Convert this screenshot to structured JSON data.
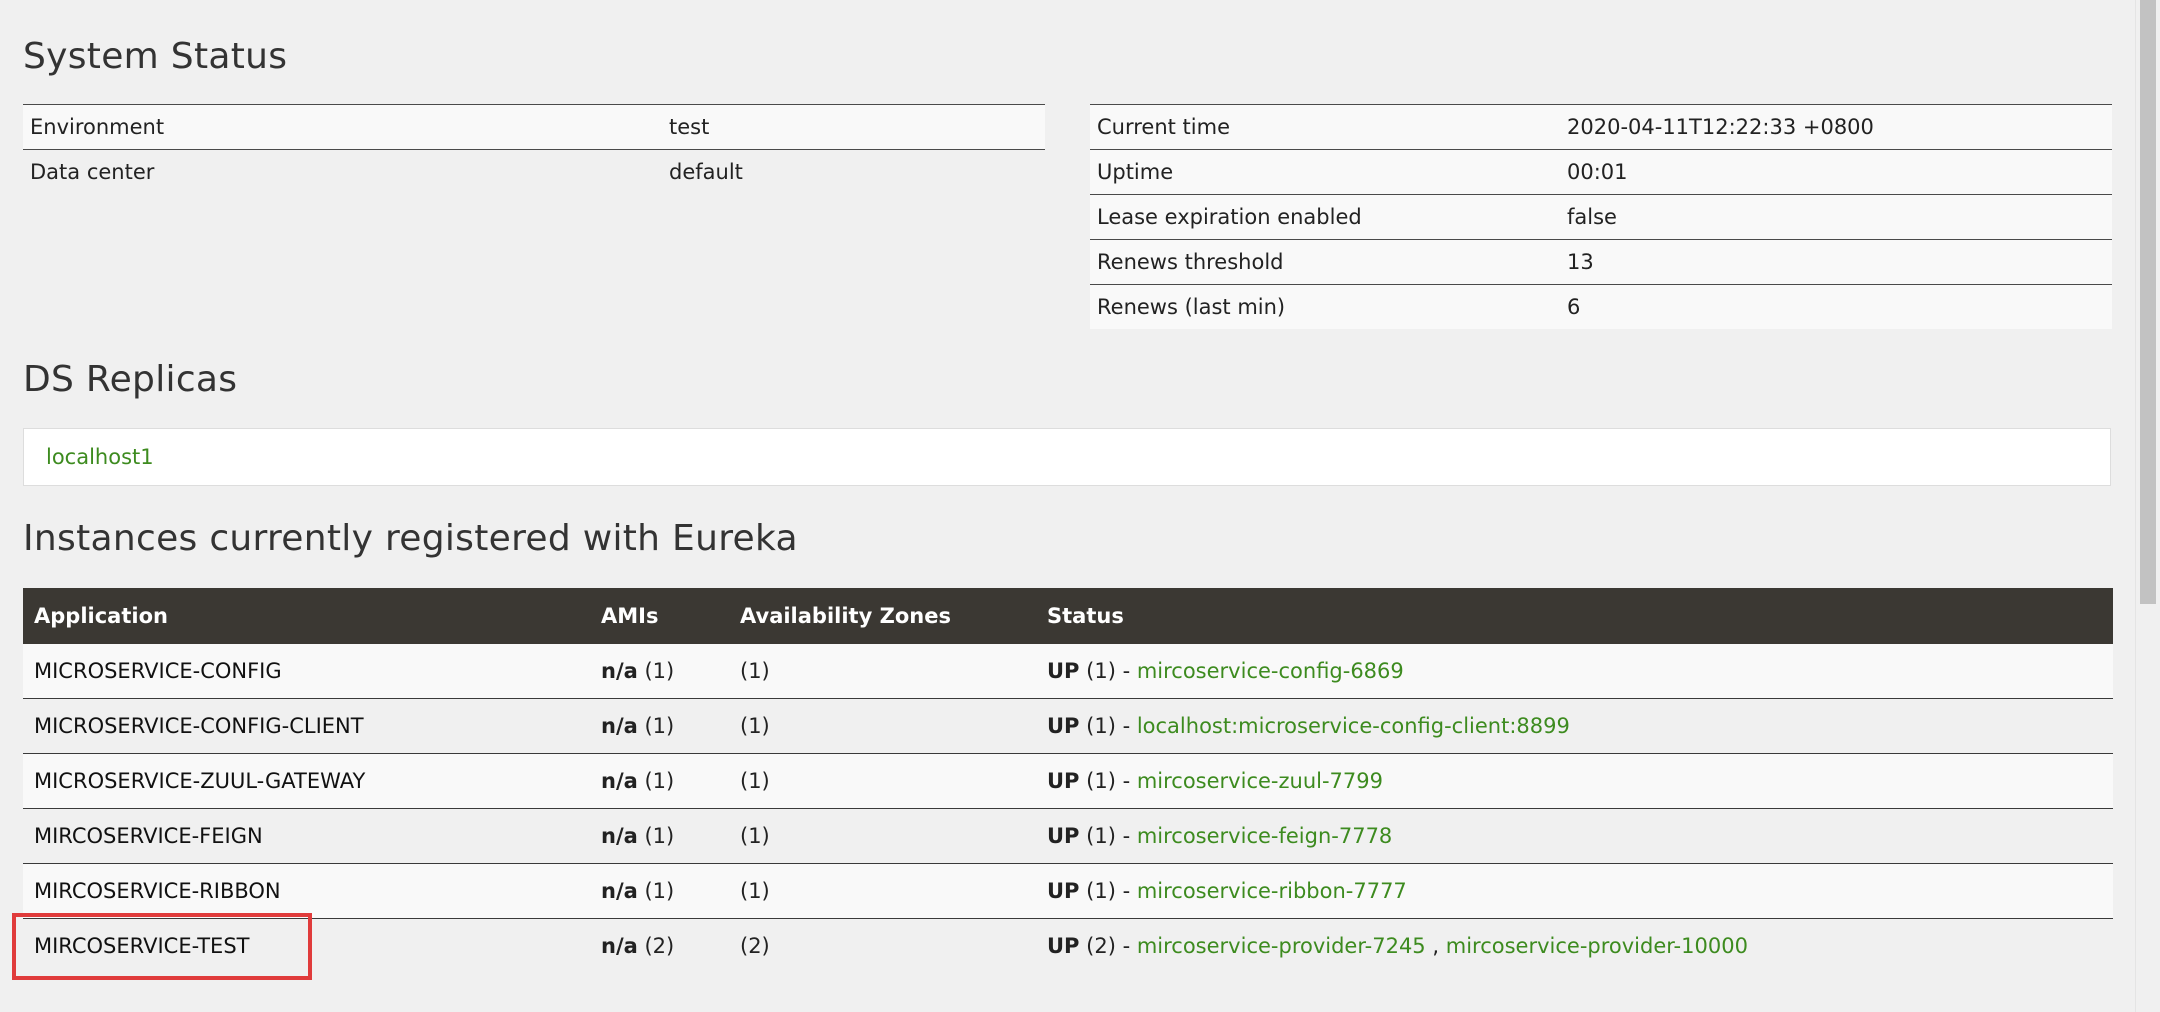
{
  "system_status": {
    "title": "System Status",
    "left_rows": [
      {
        "label": "Environment",
        "value": "test"
      },
      {
        "label": "Data center",
        "value": "default"
      }
    ],
    "right_rows": [
      {
        "label": "Current time",
        "value": "2020-04-11T12:22:33 +0800"
      },
      {
        "label": "Uptime",
        "value": "00:01"
      },
      {
        "label": "Lease expiration enabled",
        "value": "false"
      },
      {
        "label": "Renews threshold",
        "value": "13"
      },
      {
        "label": "Renews (last min)",
        "value": "6"
      }
    ]
  },
  "ds_replicas": {
    "title": "DS Replicas",
    "items": [
      "localhost1"
    ]
  },
  "instances": {
    "title": "Instances currently registered with Eureka",
    "columns": [
      "Application",
      "AMIs",
      "Availability Zones",
      "Status"
    ],
    "rows": [
      {
        "application": "MICROSERVICE-CONFIG",
        "amis_bold": "n/a",
        "amis_count": "(1)",
        "zones": "(1)",
        "status_bold": "UP",
        "status_count": "(1) -",
        "links": [
          "mircoservice-config-6869"
        ]
      },
      {
        "application": "MICROSERVICE-CONFIG-CLIENT",
        "amis_bold": "n/a",
        "amis_count": "(1)",
        "zones": "(1)",
        "status_bold": "UP",
        "status_count": "(1) -",
        "links": [
          "localhost:microservice-config-client:8899"
        ]
      },
      {
        "application": "MICROSERVICE-ZUUL-GATEWAY",
        "amis_bold": "n/a",
        "amis_count": "(1)",
        "zones": "(1)",
        "status_bold": "UP",
        "status_count": "(1) -",
        "links": [
          "mircoservice-zuul-7799"
        ]
      },
      {
        "application": "MIRCOSERVICE-FEIGN",
        "amis_bold": "n/a",
        "amis_count": "(1)",
        "zones": "(1)",
        "status_bold": "UP",
        "status_count": "(1) -",
        "links": [
          "mircoservice-feign-7778"
        ]
      },
      {
        "application": "MIRCOSERVICE-RIBBON",
        "amis_bold": "n/a",
        "amis_count": "(1)",
        "zones": "(1)",
        "status_bold": "UP",
        "status_count": "(1) -",
        "links": [
          "mircoservice-ribbon-7777"
        ]
      },
      {
        "application": "MIRCOSERVICE-TEST",
        "amis_bold": "n/a",
        "amis_count": "(2)",
        "zones": "(2)",
        "status_bold": "UP",
        "status_count": "(2) -",
        "links": [
          "mircoservice-provider-7245",
          "mircoservice-provider-10000"
        ],
        "link_separator": ","
      }
    ]
  },
  "colors": {
    "link": "#3d8b1f",
    "table_header": "#3b3833",
    "highlight": "#e03b3b",
    "page_background": "#f0f0f0"
  }
}
